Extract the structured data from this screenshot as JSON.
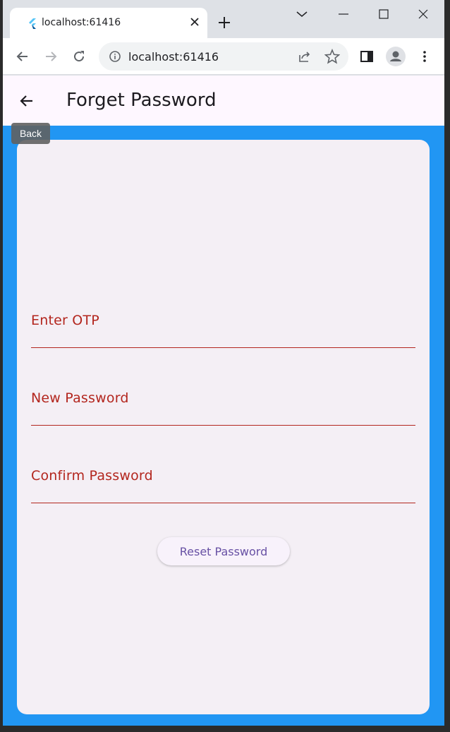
{
  "browser": {
    "tab": {
      "title": "localhost:61416",
      "favicon": "flutter-logo",
      "close_icon": "close-icon"
    },
    "new_tab_icon": "plus-icon",
    "window_controls": [
      "chevron-down-icon",
      "minimize-icon",
      "maximize-icon",
      "close-icon"
    ],
    "omnibox": {
      "url": "localhost:61416",
      "info_icon": "info-icon"
    }
  },
  "app": {
    "appbar": {
      "title": "Forget Password",
      "back_icon": "arrow-left-icon"
    },
    "tooltip": "Back",
    "fields": [
      {
        "label": "Enter OTP"
      },
      {
        "label": "New Password"
      },
      {
        "label": "Confirm Password"
      }
    ],
    "reset_button": "Reset Password",
    "colors": {
      "page_background": "#2196f3",
      "card_background": "#f4eff5",
      "field_label": "#b3261e",
      "button_text": "#6750a4"
    }
  }
}
